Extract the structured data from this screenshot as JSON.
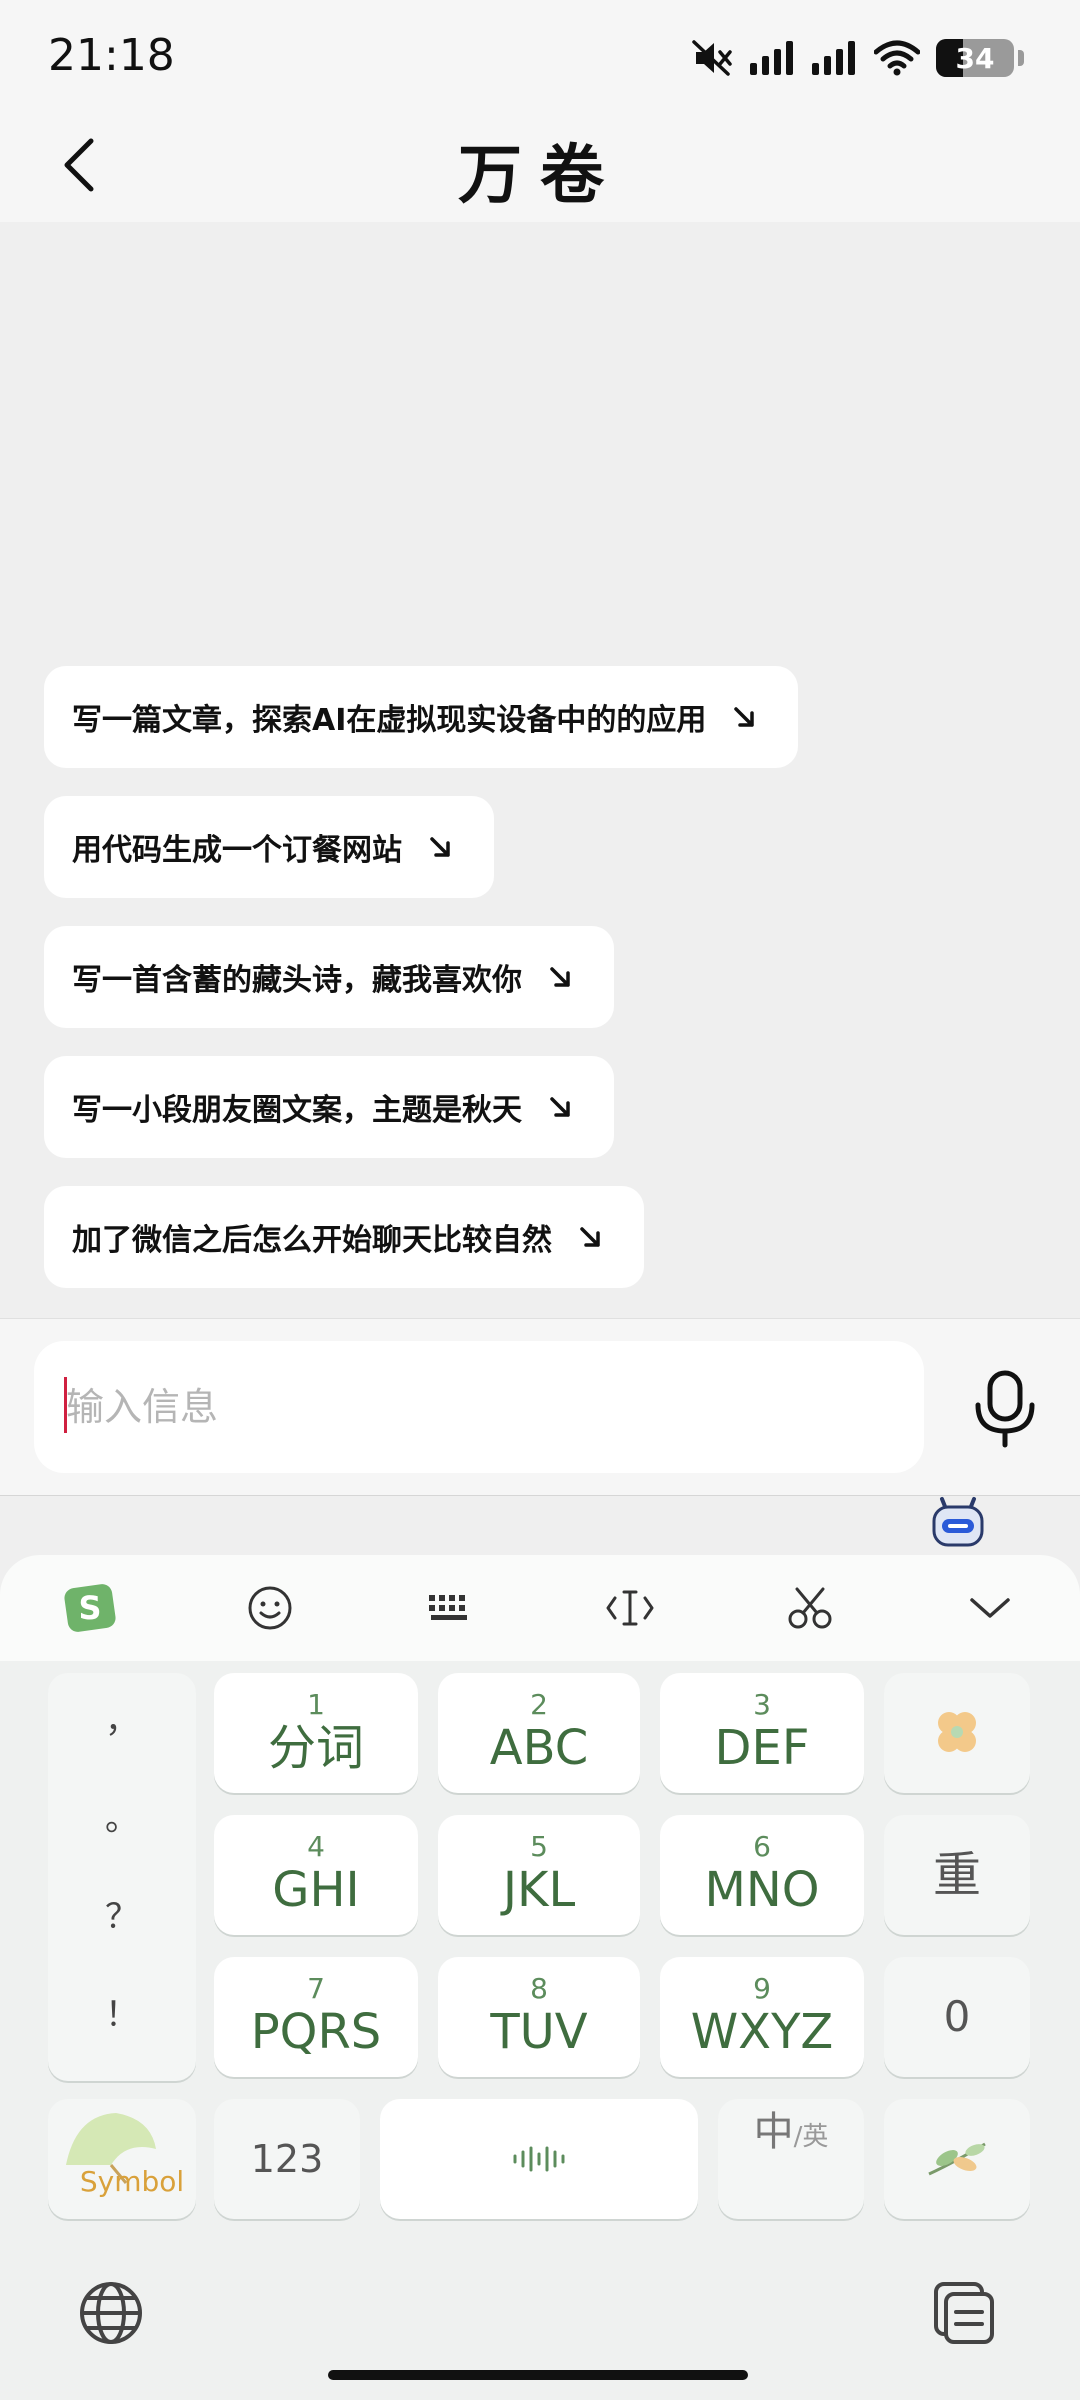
{
  "status_bar": {
    "time": "21:18",
    "battery": "34",
    "icons": [
      "mute-icon",
      "signal-icon",
      "signal-icon",
      "wifi-icon",
      "battery-icon"
    ]
  },
  "header": {
    "title": "万卷",
    "back_icon": "chevron-left-icon"
  },
  "suggestions": [
    {
      "label": "写一篇文章，探索AI在虚拟现实设备中的的应用"
    },
    {
      "label": "用代码生成一个订餐网站"
    },
    {
      "label": "写一首含蓄的藏头诗，藏我喜欢你"
    },
    {
      "label": "写一小段朋友圈文案，主题是秋天"
    },
    {
      "label": "加了微信之后怎么开始聊天比较自然"
    }
  ],
  "input": {
    "placeholder": "输入信息",
    "value": "",
    "mic_icon": "microphone-icon"
  },
  "keyboard": {
    "toolbar": [
      "sogou-logo-icon",
      "emoji-icon",
      "keyboard-icon",
      "cursor-icon",
      "scissors-icon",
      "chevron-down-icon"
    ],
    "punctuation": [
      "，",
      "。",
      "？",
      "！"
    ],
    "keys": [
      {
        "num": "1",
        "letters": "分词"
      },
      {
        "num": "2",
        "letters": "ABC"
      },
      {
        "num": "3",
        "letters": "DEF"
      },
      {
        "num": "4",
        "letters": "GHI"
      },
      {
        "num": "5",
        "letters": "JKL"
      },
      {
        "num": "6",
        "letters": "MNO"
      },
      {
        "num": "7",
        "letters": "PQRS"
      },
      {
        "num": "8",
        "letters": "TUV"
      },
      {
        "num": "9",
        "letters": "WXYZ"
      }
    ],
    "side_keys": {
      "clover": "clover-icon",
      "reset": "重",
      "zero": "0"
    },
    "bottom_row": {
      "symbol": "Symbol",
      "numbers": "123",
      "space_icon": "voice-wave-icon",
      "lang_main": "中",
      "lang_sub": "/英",
      "leaf": "leaf-icon"
    }
  },
  "nav": {
    "globe": "globe-icon",
    "clipboard": "clipboard-icon"
  },
  "colors": {
    "accent_green": "#3f6d3f",
    "caret": "#d02040"
  }
}
